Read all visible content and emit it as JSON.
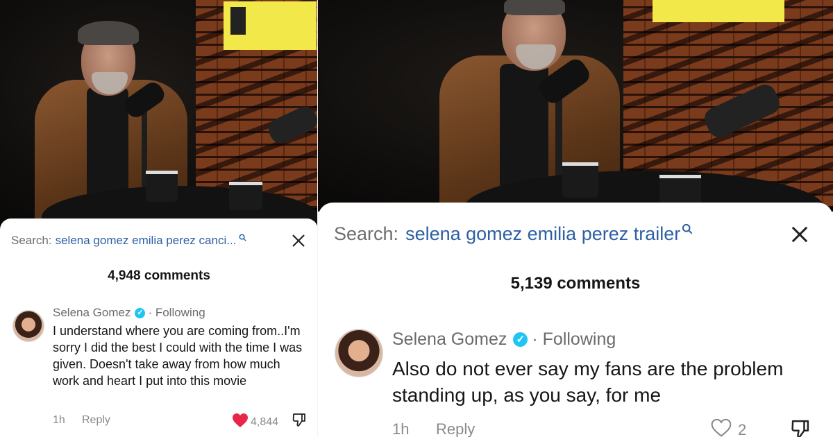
{
  "left": {
    "search": {
      "prefix": "Search:",
      "query": "selena gomez emilia perez canci..."
    },
    "comments_count": "4,948 comments",
    "comment": {
      "author": "Selena Gomez",
      "verified": "✓",
      "relation": "· Following",
      "text": "I understand where you are coming from..I'm sorry I did the best I could with the time I was given. Doesn't take away from how much work and heart I put into this movie",
      "time": "1h",
      "reply_label": "Reply",
      "likes": "4,844",
      "liked": true
    }
  },
  "right": {
    "search": {
      "prefix": "Search:",
      "query": "selena gomez emilia perez trailer"
    },
    "comments_count": "5,139 comments",
    "comment": {
      "author": "Selena Gomez",
      "verified": "✓",
      "relation": "· Following",
      "text": "Also do not ever say my fans are the problem standing up, as you say, for me",
      "time": "1h",
      "reply_label": "Reply",
      "likes": "2",
      "liked": false
    }
  },
  "colors": {
    "search_query": "#2d5fa3",
    "verified_badge": "#20c5f2",
    "liked_heart": "#e8264a",
    "muted_text": "#8a8a8a"
  },
  "icons": [
    "search-icon",
    "close-icon",
    "verified-icon",
    "heart-icon",
    "dislike-icon"
  ]
}
